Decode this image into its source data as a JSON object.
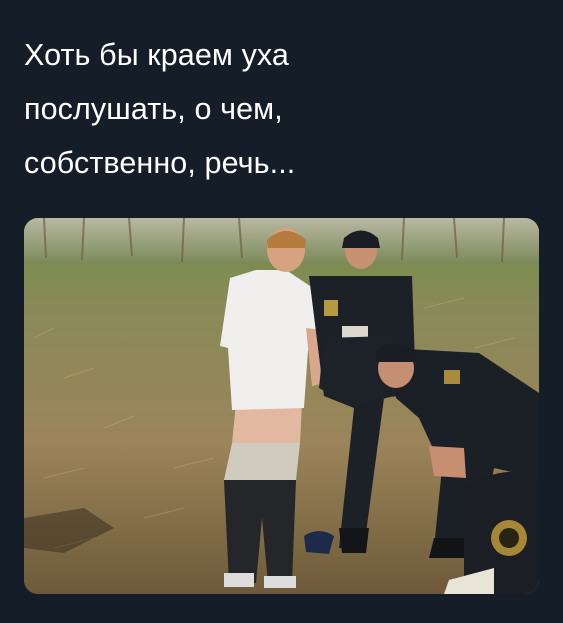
{
  "tweet": {
    "text_lines": [
      "Хоть бы краем уха",
      "послушать, о чем,",
      "собственно, речь..."
    ]
  },
  "photo": {
    "subject": "photo-people-in-field"
  },
  "colors": {
    "background": "#151d29",
    "text": "#ffffff"
  }
}
